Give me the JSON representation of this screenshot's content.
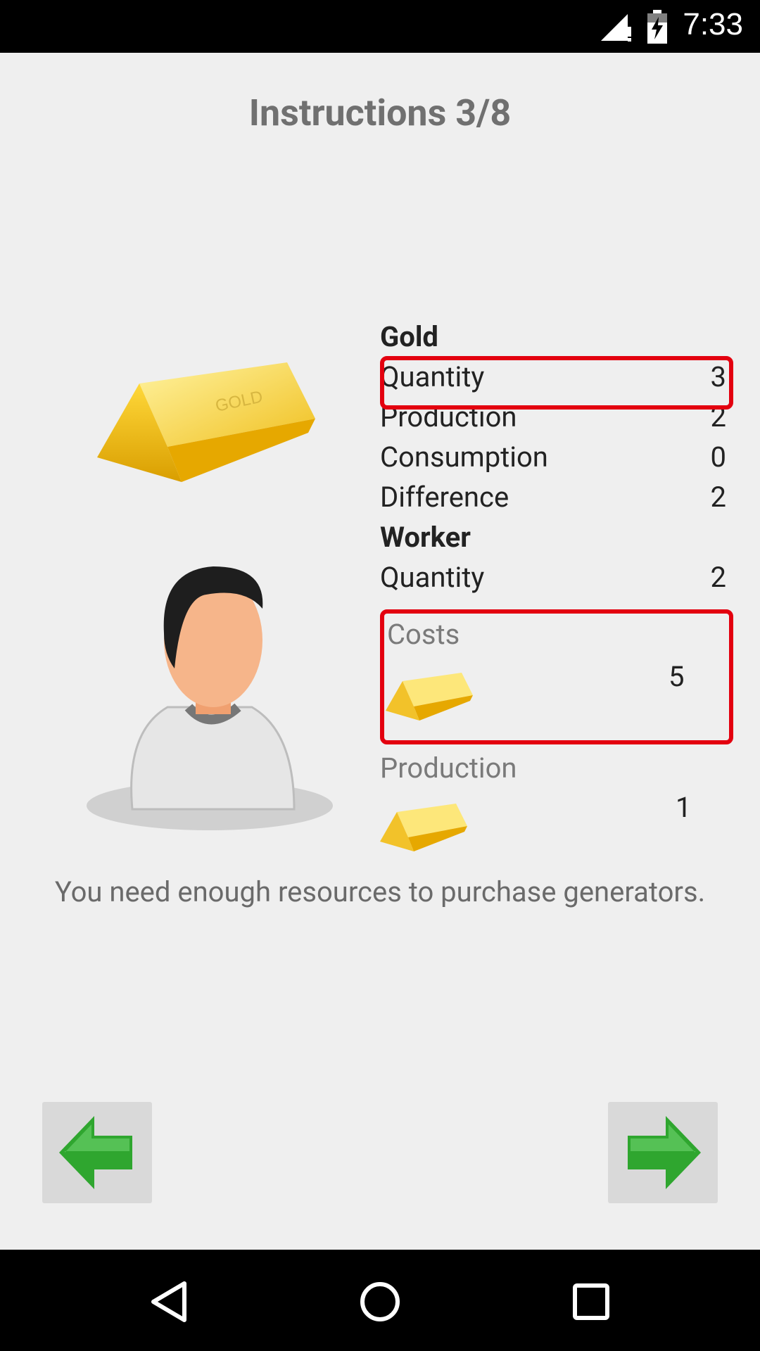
{
  "status_bar": {
    "time": "7:33",
    "icons": [
      "signal-icon",
      "battery-charging-icon"
    ]
  },
  "header": {
    "title": "Instructions 3/8"
  },
  "gold": {
    "section_title": "Gold",
    "rows": [
      {
        "label": "Quantity",
        "value": "3"
      },
      {
        "label": "Production",
        "value": "2"
      },
      {
        "label": "Consumption",
        "value": "0"
      },
      {
        "label": "Difference",
        "value": "2"
      }
    ]
  },
  "worker": {
    "section_title": "Worker",
    "quantity_label": "Quantity",
    "quantity_value": "2",
    "costs_label": "Costs",
    "costs_value": "5",
    "production_label": "Production",
    "production_value": "1"
  },
  "message": "You need enough resources to purchase generators.",
  "buttons": {
    "back": "back-arrow-icon",
    "next": "next-arrow-icon"
  },
  "colors": {
    "highlight": "#e3000f",
    "arrow_green": "#2fa62f",
    "background": "#efefef"
  }
}
